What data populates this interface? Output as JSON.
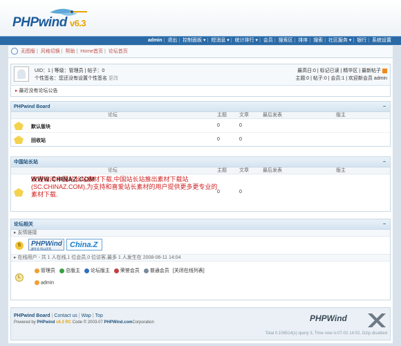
{
  "brand": {
    "name": "PHPwind",
    "version": "v6.3"
  },
  "topnav": {
    "user": "admin",
    "items": [
      "退出",
      "控制面板 ▾",
      "短消息 ▾",
      "统计排行 ▾",
      "会员",
      "搜索区",
      "排序",
      "搜索",
      "社区服务 ▾",
      "银行",
      "系统设置"
    ]
  },
  "subnav": {
    "items": [
      "无图版",
      "风格切换",
      "帮助",
      "Home首页",
      "论坛首页"
    ]
  },
  "user": {
    "line1": "UID：1 | 等级：管理员 | 帖子：0",
    "line2_label": "个性签名：",
    "line2_value": "您还没有设置个性签名",
    "line2_edit": "更改"
  },
  "stats": {
    "line1": "最高日:0 | 标记已读 | 精华区 | 最新帖子",
    "line2": "主题:0 | 帖子:0 | 会员:1 | 欢迎新会员 admin"
  },
  "notice": "最近没有论坛公告",
  "col_headers": {
    "forum": "论坛",
    "topics": "主题",
    "posts": "文章",
    "last": "最后发表",
    "mod": "版主"
  },
  "section1": {
    "title": "PHPwind Board",
    "rows": [
      {
        "name": "默认版块",
        "topics": "0",
        "posts": "0"
      },
      {
        "name": "回收站",
        "topics": "0",
        "posts": "0"
      }
    ]
  },
  "section2": {
    "title": "中国站长站",
    "row": {
      "url": "WWW.CHINAZ.COM",
      "desc": "欢迎访问中国站长站素材下载,中国站长站推出素材下载站(SC.CHINAZ.COM),为支持和喜爱站长素材的用户提供更多更专业的素材下载.",
      "topics": "0",
      "posts": "0"
    }
  },
  "section3": {
    "title": "论坛相关",
    "links_label": "友情链接",
    "logo_pw": {
      "main": "PHPWind",
      "tag": "越专业 所以优秀"
    },
    "logo_cz": {
      "main": "China.Z"
    },
    "online_text": "在线用户 - 共 1 人在线,1 位会员,0 位访客,最多 1 人发生在 2008-06-11 14:04",
    "legend": [
      {
        "label": "管理员",
        "color": "#f0a030"
      },
      {
        "label": "总版主",
        "color": "#3aa040"
      },
      {
        "label": "论坛版主",
        "color": "#3070c0"
      },
      {
        "label": "荣誉会员",
        "color": "#c04040"
      },
      {
        "label": "普通会员",
        "color": "#7a8a99"
      }
    ],
    "close_list": "[关闭在线列表]",
    "online_user": "admin"
  },
  "footer": {
    "links": [
      "PHPwind Board",
      "Contact us",
      "Wap",
      "Top"
    ],
    "powered_prefix": "Powered by",
    "powered_brand": "PHPwind",
    "powered_version": "v6.3 RC",
    "powered_code": "Code © 2003-07",
    "powered_site": "PHPWind.com",
    "powered_corp": "Corporation",
    "debug": "Total 0.106514(s) query 3, Time now is:07-02 14:02, Gzip disabled",
    "logo_text": "PHPWind"
  },
  "colors": {
    "accent": "#2a6aa6",
    "brand": "#1d5b9a",
    "highlight": "#c0504d"
  }
}
